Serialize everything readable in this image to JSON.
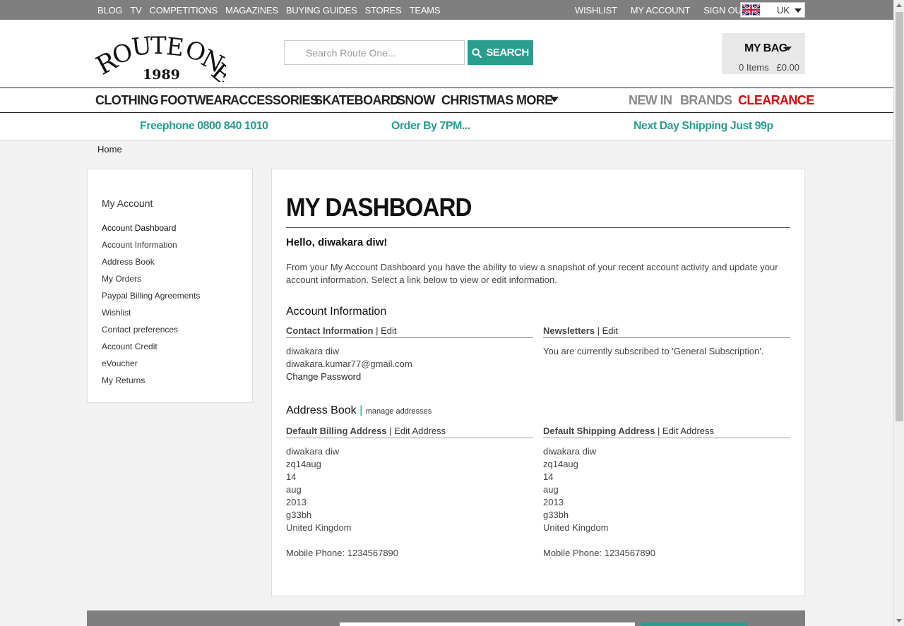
{
  "topbar": {
    "left_links": [
      "BLOG",
      "TV",
      "COMPETITIONS",
      "MAGAZINES",
      "BUYING GUIDES",
      "STORES",
      "TEAMS"
    ],
    "right_links": [
      "WISHLIST",
      "MY ACCOUNT",
      "SIGN OUT"
    ],
    "country_code": "UK",
    "flag_icon": "uk-flag-icon"
  },
  "header": {
    "logo_text": "ROUTE ONE",
    "logo_year": "1989",
    "search_placeholder": "Search Route One...",
    "search_label": "SEARCH",
    "bag_title": "MY BAG",
    "bag_items": "0 Items",
    "bag_total": "£0.00",
    "accent_color": "#2a9d8f"
  },
  "nav": {
    "items": [
      "CLOTHING",
      "FOOTWEAR",
      "ACCESSORIES",
      "SKATEBOARD",
      "SNOW",
      "CHRISTMAS",
      "MORE"
    ],
    "right_items": [
      "NEW IN",
      "BRANDS",
      "CLEARANCE"
    ],
    "clearance_color": "#e00000"
  },
  "promo": {
    "phone": "Freephone 0800 840 1010",
    "order": "Order By 7PM...",
    "shipping": "Next Day Shipping Just 99p"
  },
  "breadcrumb": "Home",
  "sidebar": {
    "title": "My Account",
    "items": [
      "Account Dashboard",
      "Account Information",
      "Address Book",
      "My Orders",
      "Paypal Billing Agreements",
      "Wishlist",
      "Contact preferences",
      "Account Credit",
      "eVoucher",
      "My Returns"
    ]
  },
  "dashboard": {
    "title": "MY DASHBOARD",
    "hello": "Hello, diwakara diw!",
    "intro": "From your My Account Dashboard you have the ability to view a snapshot of your recent account activity and update your account information. Select a link below to view or edit information.",
    "account_info_title": "Account Information",
    "contact_head": "Contact Information",
    "contact_edit": "Edit",
    "contact_name": "diwakara diw",
    "contact_email": "diwakara.kumar77@gmail.com",
    "change_password": "Change Password",
    "newsletters_head": "Newsletters",
    "newsletters_edit": "Edit",
    "newsletters_text": "You are currently subscribed to 'General Subscription'.",
    "address_book_title": "Address Book",
    "manage_addresses": "manage addresses",
    "billing_head": "Default Billing Address",
    "shipping_head": "Default Shipping Address",
    "edit_address": "Edit Address",
    "billing_lines": [
      "diwakara diw",
      "zq14aug",
      "14",
      "aug",
      "2013",
      "g33bh",
      "United Kingdom"
    ],
    "shipping_lines": [
      "diwakara diw",
      "zq14aug",
      "14",
      "aug",
      "2013",
      "g33bh",
      "United Kingdom"
    ],
    "billing_phone": "Mobile Phone: 1234567890",
    "shipping_phone": "Mobile Phone: 1234567890"
  }
}
